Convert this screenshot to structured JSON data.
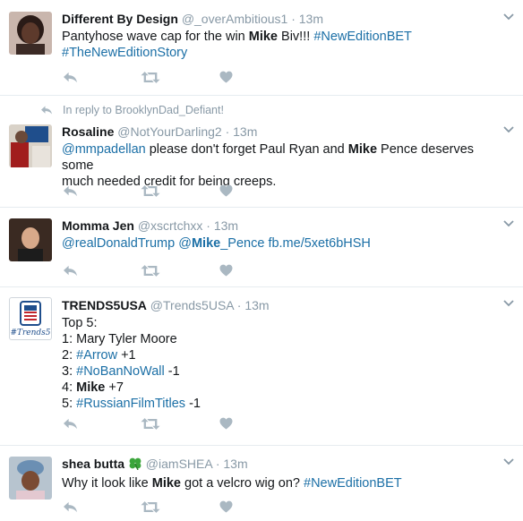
{
  "colors": {
    "link": "#1b6fa6",
    "muted": "#8899a6",
    "divider": "#e6ecf0"
  },
  "icons": [
    "reply-icon",
    "retweet-icon",
    "like-icon",
    "chevron-down-icon",
    "clover-icon"
  ],
  "tweets": [
    {
      "fullname": "Different By Design",
      "handle": "@_overAmbitious1",
      "time": "13m",
      "text": [
        {
          "t": "Pantyhose wave cap for the win "
        },
        {
          "t": "Mike",
          "bold": true
        },
        {
          "t": " Biv!!! "
        },
        {
          "t": "#NewEditionBET",
          "link": true
        },
        {
          "t": "#TheNewEditionStory",
          "link": true
        }
      ]
    },
    {
      "reply_to": "In reply to BrooklynDad_Defiant!",
      "fullname": "Rosaline",
      "handle": "@NotYourDarling2",
      "time": "13m",
      "text": [
        {
          "t": "@mmpadellan",
          "link": true
        },
        {
          "t": " please don't forget Paul Ryan and "
        },
        {
          "t": "Mike",
          "bold": true
        },
        {
          "t": " Pence deserves some"
        },
        {
          "t": "much needed credit for being creeps."
        }
      ]
    },
    {
      "fullname": "Momma Jen",
      "handle": "@xscrtchxx",
      "time": "13m",
      "text": [
        {
          "t": "@realDonaldTrump",
          "link": true
        },
        {
          "t": " "
        },
        {
          "t": "@",
          "link": true
        },
        {
          "t": "Mike",
          "bold": true
        },
        {
          "t": "_Pence",
          "link": true
        },
        {
          "t": " "
        },
        {
          "t": "fb.me/5xet6bHSH",
          "link": true
        }
      ]
    },
    {
      "fullname": "TRENDS5USA",
      "handle": "@Trends5USA",
      "time": "13m",
      "avatar_text": "#Trends5",
      "text": [
        {
          "t": "Top 5:"
        },
        {
          "t": "1: Mary Tyler Moore"
        },
        {
          "t": "2: "
        },
        {
          "t": "#Arrow",
          "link": true
        },
        {
          "t": " +1"
        },
        {
          "t": "3: "
        },
        {
          "t": "#NoBanNoWall",
          "link": true
        },
        {
          "t": " -1"
        },
        {
          "t": "4: "
        },
        {
          "t": "Mike",
          "bold": true
        },
        {
          "t": " +7"
        },
        {
          "t": "5: "
        },
        {
          "t": "#RussianFilmTitles",
          "link": true
        },
        {
          "t": " -1"
        }
      ]
    },
    {
      "fullname": "shea butta",
      "handle": "@iamSHEA",
      "time": "13m",
      "text": [
        {
          "t": "Why it look like "
        },
        {
          "t": "Mike",
          "bold": true
        },
        {
          "t": " got a velcro wig on? "
        },
        {
          "t": "#NewEditionBET",
          "link": true
        }
      ]
    }
  ]
}
